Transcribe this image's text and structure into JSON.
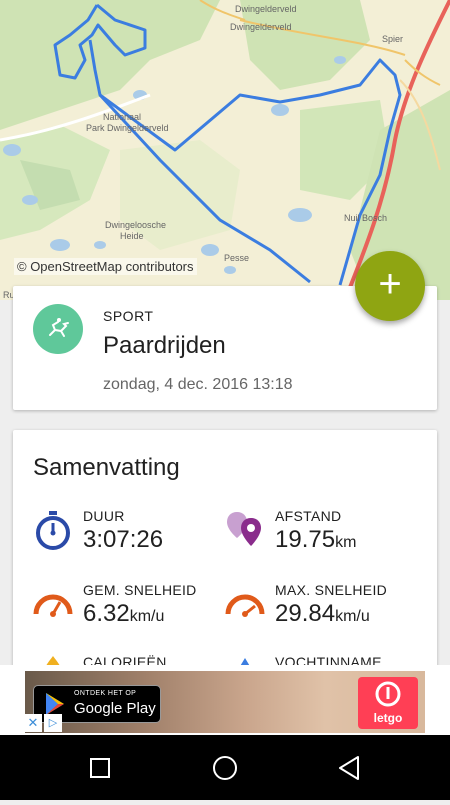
{
  "map": {
    "attribution": "© OpenStreetMap contributors",
    "labels": {
      "dwingelderveld": "Dwingelderveld",
      "spier": "Spier",
      "nationaal_park_line1": "Nationaal",
      "nationaal_park_line2": "Park Dwingelderveld",
      "dwingeloosche_line1": "Dwingeloosche",
      "dwingeloosche_line2": "Heide",
      "nuil": "Nuil",
      "bosch": "Bosch",
      "pesse": "Pesse",
      "edge_left": "Ru"
    },
    "route_color": "#3b7de0"
  },
  "fab": {
    "icon": "plus-icon",
    "label": "+",
    "color": "#8fa512"
  },
  "sport": {
    "label": "SPORT",
    "name": "Paardrijden",
    "date": "zondag, 4 dec. 2016 13:18",
    "icon": "horse-riding-icon",
    "icon_color": "#5fc89a"
  },
  "summary": {
    "title": "Samenvatting",
    "stats": {
      "duration": {
        "label": "DUUR",
        "value": "3:07:26",
        "unit": "",
        "icon": "stopwatch-icon",
        "color": "#2a4aa8"
      },
      "distance": {
        "label": "AFSTAND",
        "value": "19.75",
        "unit": "km",
        "icon": "location-pins-icon",
        "color": "#8a2c8c"
      },
      "avg_speed": {
        "label": "GEM. SNELHEID",
        "value": "6.32",
        "unit": "km/u",
        "icon": "speedometer-icon",
        "color": "#e05a1a"
      },
      "max_speed": {
        "label": "MAX. SNELHEID",
        "value": "29.84",
        "unit": "km/u",
        "icon": "speedometer-icon",
        "color": "#e05a1a"
      },
      "calories": {
        "label": "CALORIEËN",
        "icon": "flame-icon",
        "color": "#f0b020"
      },
      "hydration": {
        "label": "VOCHTINNAME",
        "icon": "droplet-icon",
        "color": "#3b7de0"
      }
    }
  },
  "ad": {
    "google_play_top": "ONTDEK HET OP",
    "google_play_main": "Google Play",
    "brand": "letgo",
    "close": "✕",
    "adchoices": "▷"
  },
  "navbar": {
    "recent": "recent-apps-icon",
    "home": "home-icon",
    "back": "back-icon"
  }
}
